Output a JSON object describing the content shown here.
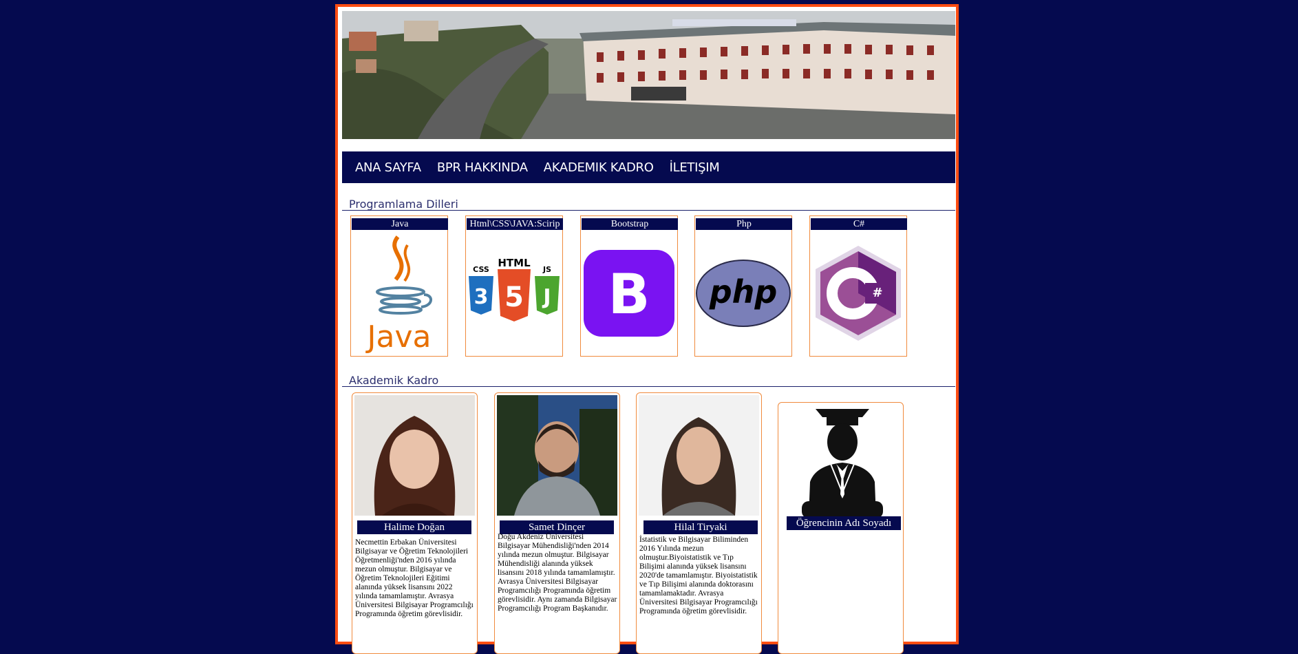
{
  "nav": {
    "items": [
      "ANA SAYFA",
      "BPR HAKKINDA",
      "AKADEMIK KADRO",
      "İLETIŞIM"
    ]
  },
  "sections": {
    "languages_title": "Programlama Dilleri",
    "staff_title": "Akademik Kadro"
  },
  "languages": [
    {
      "label": "Java",
      "logo": "java-logo",
      "logo_text": "Java"
    },
    {
      "label": "Html\\CSS\\JAVA:Scirip",
      "logo": "html-css-js-logo",
      "logo_text": [
        "CSS",
        "HTML",
        "JS"
      ]
    },
    {
      "label": "Bootstrap",
      "logo": "bootstrap-logo",
      "logo_text": "B"
    },
    {
      "label": "Php",
      "logo": "php-logo",
      "logo_text": "php"
    },
    {
      "label": "C#",
      "logo": "csharp-logo",
      "logo_text": "C#"
    }
  ],
  "staff": [
    {
      "name": "Halime Doğan",
      "bio": "Necmettin Erbakan Üniversitesi Bilgisayar ve Öğretim Teknolojileri Öğretmenliği'nden 2016 yılında mezun olmuştur. Bilgisayar ve Öğretim Teknolojileri Eğitimi alanında yüksek lisansını 2022 yılında tamamlamıştır. Avrasya Üniversitesi Bilgisayar Programcılığı Programında öğretim görevlisidir."
    },
    {
      "name": "Samet Dinçer",
      "bio": "Doğu Akdeniz Üniversitesi Bilgisayar Mühendisliği'nden 2014 yılında mezun olmuştur. Bilgisayar Mühendisliği alanında yüksek lisansını 2018 yılında tamamlamıştır. Avrasya Üniversitesi Bilgisayar Programcılığı Programında öğretim görevlisidir. Aynı zamanda Bilgisayar Programcılığı Program Başkanıdır."
    },
    {
      "name": "Hilal Tiryaki",
      "bio": "İstatistik ve Bilgisayar Biliminden 2016 Yılında mezun olmuştur.Biyoistatistik ve Tıp Bilişimi alanında yüksek lisansını 2020'de tamamlamıştır. Biyoistatistik ve Tıp Bilişimi alanında doktorasını tamamlamaktadır. Avrasya Üniversitesi Bilgisayar Programcılığı Programında öğretim görevlisidir."
    },
    {
      "name": "Öğrencinin Adı Soyadı",
      "bio": ""
    }
  ],
  "colors": {
    "navy": "#050a4f",
    "accent_orange": "#ff4d12",
    "card_border": "#f08a3c"
  }
}
